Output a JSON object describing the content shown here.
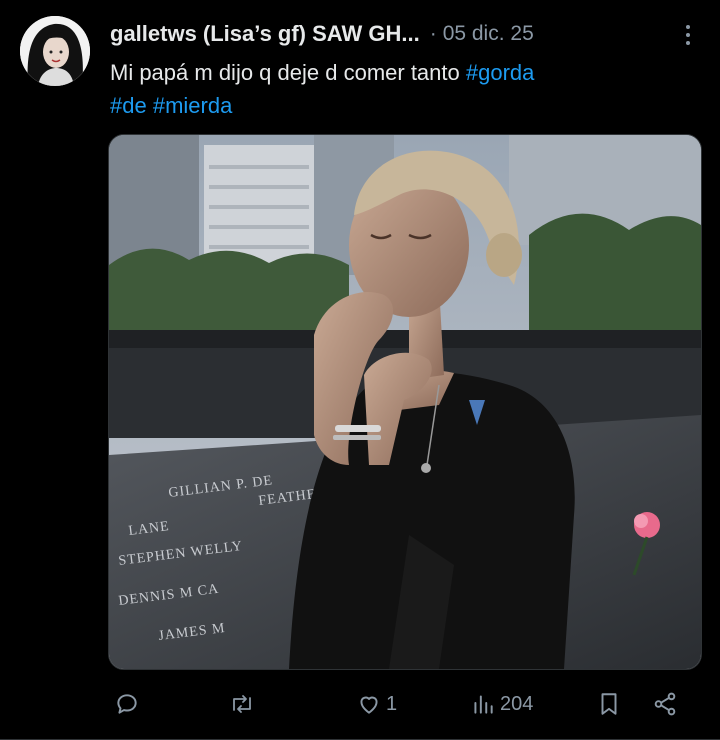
{
  "tweet": {
    "display_name": "galletws (Lisa’s gf) SAW GH...",
    "separator": "·",
    "date": "05 dic. 25",
    "text_prefix": "Mi papá m dijo q deje d comer tanto ",
    "hashtags": [
      "#gorda",
      "#de",
      "#mierda"
    ],
    "media_text": {
      "names_line1": "GILLIAN P. DE",
      "names_line2": "FEATHERS",
      "names_line3": "LANE",
      "names_line4": "STEPHEN WELLY",
      "names_line5": "DENNIS M CA",
      "names_line6": "JAMES M"
    }
  },
  "actions": {
    "reply": {
      "icon": "reply-icon",
      "count": ""
    },
    "retweet": {
      "icon": "retweet-icon",
      "count": ""
    },
    "like": {
      "icon": "heart-icon",
      "count": "1"
    },
    "views": {
      "icon": "views-icon",
      "count": "204"
    },
    "bookmark": {
      "icon": "bookmark-icon"
    },
    "share": {
      "icon": "share-icon"
    }
  },
  "colors": {
    "background": "#000000",
    "text": "#e7e9ea",
    "muted": "#8b98a5",
    "hashtag": "#1d9bf0"
  }
}
